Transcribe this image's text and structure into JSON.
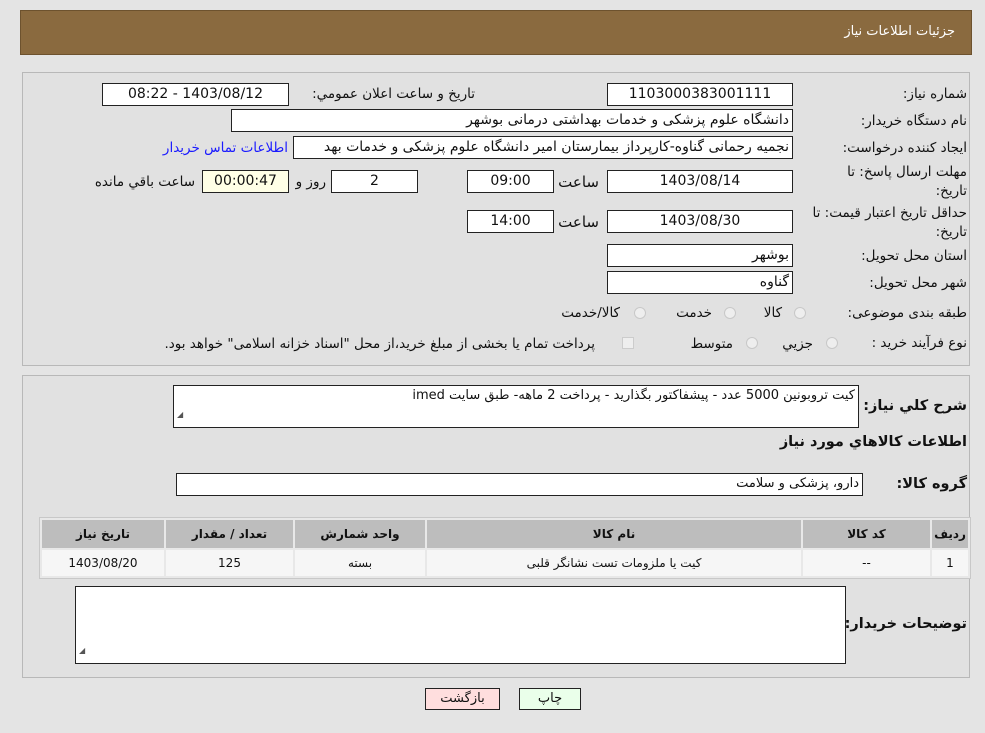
{
  "header": {
    "title": "جزئیات اطلاعات نیاز"
  },
  "form": {
    "need_number_label": "شماره نیاز:",
    "need_number": "1103000383001111",
    "announce_label": "تاریخ و ساعت اعلان عمومي:",
    "announce_value": "1403/08/12 - 08:22",
    "buyer_label": "نام دستگاه خریدار:",
    "buyer": "دانشگاه علوم پزشکی و خدمات بهداشتی درمانی بوشهر",
    "creator_label": "ایجاد کننده درخواست:",
    "creator": "نجمیه رحمانی گناوه-کارپرداز بیمارستان امیر دانشگاه علوم پزشکی و خدمات بهد",
    "contact_link": "اطلاعات تماس خریدار",
    "deadline_label1": "مهلت ارسال پاسخ: تا",
    "deadline_label2": "تاریخ:",
    "deadline_date": "1403/08/14",
    "time_label": "ساعت",
    "deadline_time": "09:00",
    "days": "2",
    "days_label": "روز و",
    "remaining": "00:00:47",
    "remaining_label": "ساعت باقي مانده",
    "validity_label1": "حداقل تاریخ اعتبار قیمت: تا",
    "validity_label2": "تاریخ:",
    "validity_date": "1403/08/30",
    "validity_time": "14:00",
    "province_label": "استان محل تحویل:",
    "province": "بوشهر",
    "city_label": "شهر محل تحویل:",
    "city": "گناوه",
    "category_label": "طبقه بندی موضوعی:",
    "category_options": [
      "کالا",
      "خدمت",
      "کالا/خدمت"
    ],
    "purchase_label": "نوع فرآیند خرید :",
    "purchase_options": [
      "جزيي",
      "متوسط"
    ],
    "purchase_note": "پرداخت تمام یا بخشی از مبلغ خرید،از محل \"اسناد خزانه اسلامی\" خواهد بود."
  },
  "details": {
    "description_label": "شرح کلي نياز:",
    "description": "کیت تروبونین 5000 عدد - پیشفاکتور بگذارید - پرداخت 2 ماهه- طبق سایت imed",
    "goods_title": "اطلاعات کالاهاي مورد نياز",
    "group_label": "گروه کالا:",
    "group": "دارو، پزشکی و سلامت",
    "table": {
      "headers": [
        "ردیف",
        "کد کالا",
        "نام کالا",
        "واحد شمارش",
        "تعداد / مقدار",
        "تاریخ نیاز"
      ],
      "rows": [
        [
          "1",
          "--",
          "کیت یا ملزومات تست نشانگر قلبی",
          "بسته",
          "125",
          "1403/08/20"
        ]
      ]
    },
    "notes_label": "توضیحات خریدار:",
    "notes": ""
  },
  "buttons": {
    "print": "چاپ",
    "back": "بازگشت"
  }
}
